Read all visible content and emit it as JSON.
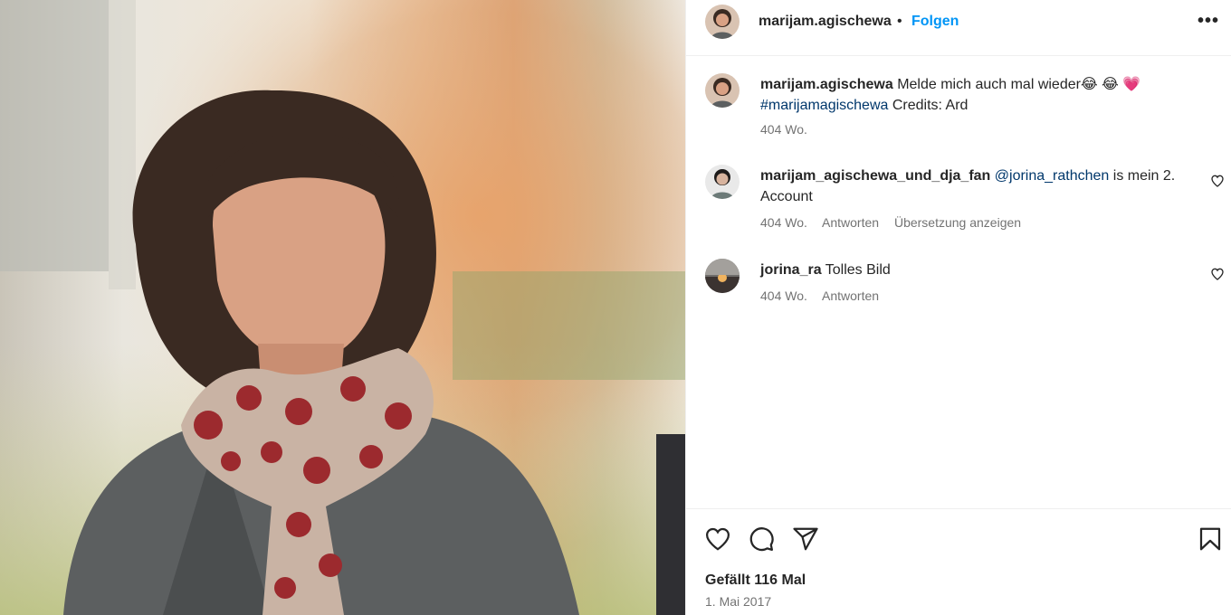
{
  "post": {
    "author": "marijam.agischewa",
    "follow_label": "Folgen",
    "separator": "•",
    "more_icon": "more-options-icon",
    "more_label": "•••"
  },
  "comments": [
    {
      "user": "marijam.agischewa",
      "text": " Melde mich auch mal wieder😂 😂 💗",
      "hashtag": "#marijamagischewa",
      "text2": " Credits: Ard",
      "time": "404 Wo."
    },
    {
      "user": "marijam_agischewa_und_dja_fan",
      "mention": "@jorina_rathchen",
      "text": " is mein 2. Account",
      "time": "404 Wo.",
      "reply": "Antworten",
      "translate": "Übersetzung anzeigen"
    },
    {
      "user": "jorina_ra",
      "text": " Tolles Bild",
      "time": "404 Wo.",
      "reply": "Antworten"
    }
  ],
  "footer": {
    "likes": "Gefällt 116 Mal",
    "date": "1. Mai 2017"
  },
  "icons": [
    "heart-icon",
    "comment-icon",
    "share-icon",
    "bookmark-icon",
    "small-heart-icon"
  ],
  "colors": {
    "accent": "#0095f6",
    "link": "#00376b",
    "muted": "#737373",
    "text": "#262626"
  }
}
